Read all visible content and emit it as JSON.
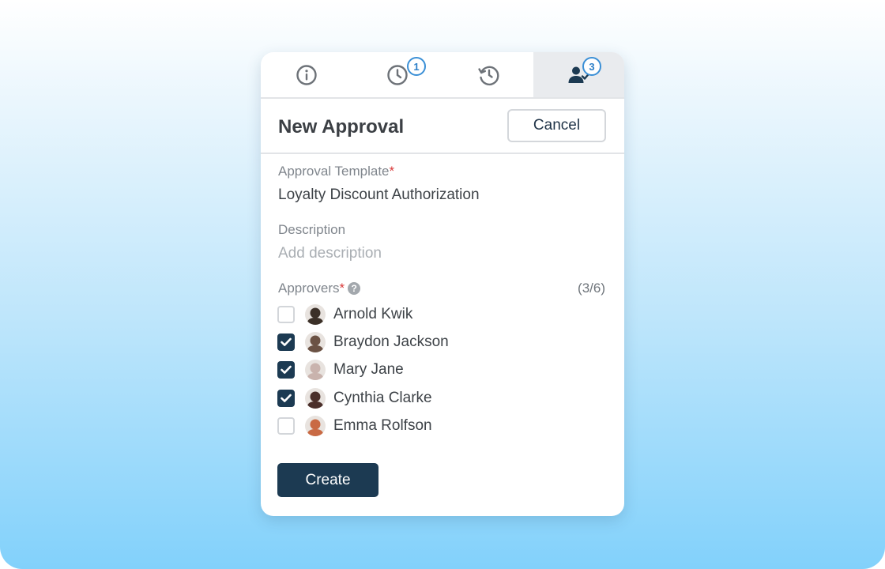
{
  "tabs": [
    {
      "icon": "info-icon",
      "badge": null
    },
    {
      "icon": "clock-icon",
      "badge": "1"
    },
    {
      "icon": "history-icon",
      "badge": null
    },
    {
      "icon": "user-check-icon",
      "badge": "3"
    }
  ],
  "header": {
    "title": "New Approval",
    "cancel_label": "Cancel"
  },
  "form": {
    "template_label": "Approval Template",
    "required_mark": "*",
    "template_value": "Loyalty Discount Authorization",
    "description_label": "Description",
    "description_placeholder": "Add description",
    "approvers_label": "Approvers",
    "help_glyph": "?",
    "approvers_count": "(3/6)"
  },
  "approvers": [
    {
      "name": "Arnold Kwik",
      "checked": false,
      "avatar_color": "#3b3028"
    },
    {
      "name": "Braydon Jackson",
      "checked": true,
      "avatar_color": "#6b5244"
    },
    {
      "name": "Mary Jane",
      "checked": true,
      "avatar_color": "#c9b3ad"
    },
    {
      "name": "Cynthia Clarke",
      "checked": true,
      "avatar_color": "#4a2f2a"
    },
    {
      "name": "Emma Rolfson",
      "checked": false,
      "avatar_color": "#c96a44"
    }
  ],
  "actions": {
    "create_label": "Create"
  },
  "colors": {
    "primary": "#1c3a52",
    "badge": "#3a8fd6",
    "required": "#d93a3a"
  }
}
